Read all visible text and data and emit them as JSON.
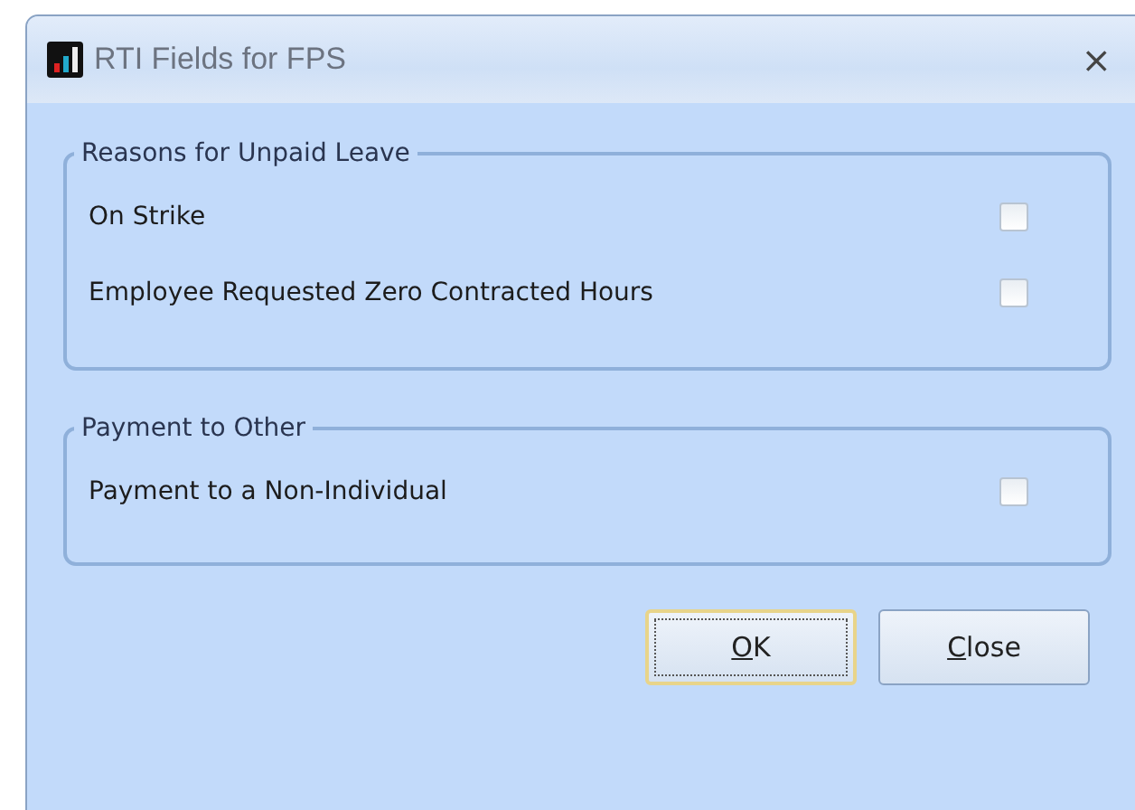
{
  "window": {
    "title": "RTI Fields for FPS",
    "close": "×"
  },
  "groups": [
    {
      "title": "Reasons for Unpaid Leave",
      "options": [
        {
          "label": "On Strike",
          "checked": false
        },
        {
          "label": "Employee Requested Zero Contracted Hours",
          "checked": false
        }
      ]
    },
    {
      "title": "Payment to Other",
      "options": [
        {
          "label": "Payment to a Non-Individual",
          "checked": false
        }
      ]
    }
  ],
  "buttons": [
    {
      "label": "OK",
      "default": true
    },
    {
      "label": "Close",
      "default": false
    }
  ]
}
